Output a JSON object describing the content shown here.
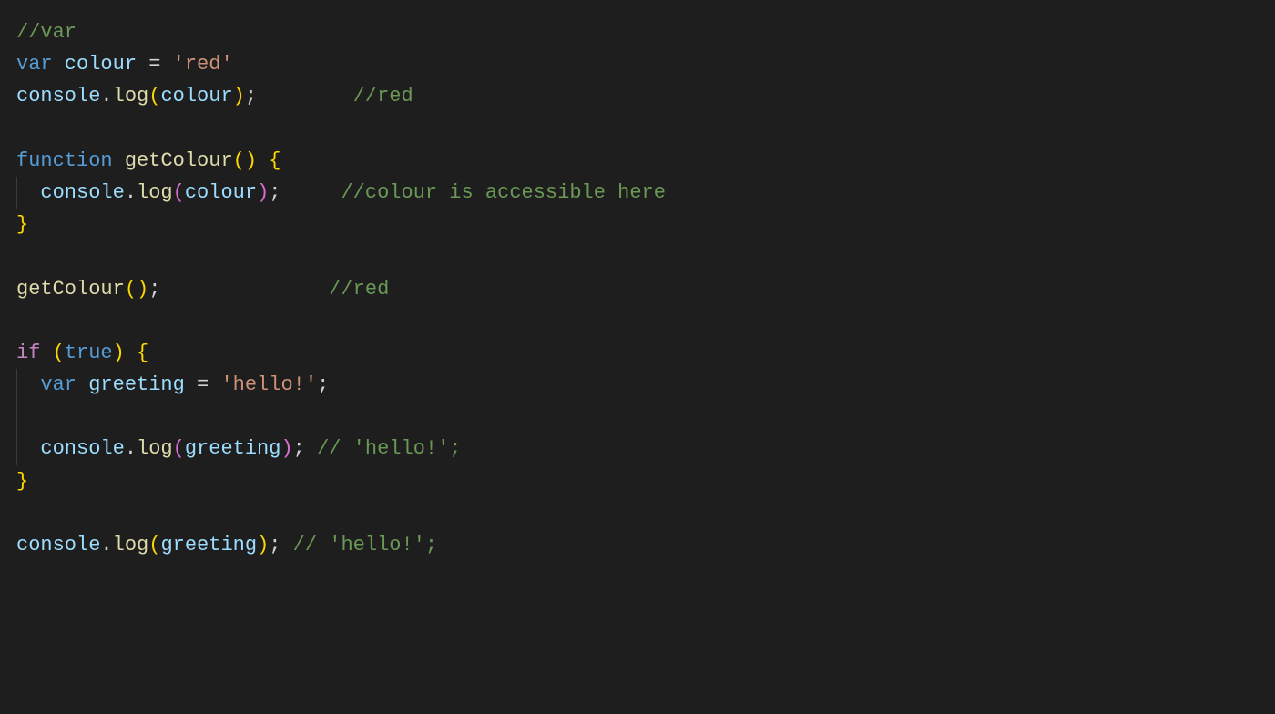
{
  "code": {
    "l1_comment": "//var",
    "l2_var": "var",
    "l2_colour": " colour ",
    "l2_eq": "= ",
    "l2_str": "'red'",
    "l3_console": "console",
    "l3_dot": ".",
    "l3_log": "log",
    "l3_open": "(",
    "l3_arg": "colour",
    "l3_close": ")",
    "l3_semi": ";",
    "l3_pad": "        ",
    "l3_comment": "//red",
    "l5_func": "function",
    "l5_name": " getColour",
    "l5_open": "(",
    "l5_close": ")",
    "l5_sp": " ",
    "l5_brace": "{",
    "l6_indent": "  ",
    "l6_console": "console",
    "l6_dot": ".",
    "l6_log": "log",
    "l6_open": "(",
    "l6_arg": "colour",
    "l6_close": ")",
    "l6_semi": ";",
    "l6_pad": "     ",
    "l6_comment": "//colour is accessible here",
    "l7_brace": "}",
    "l9_call": "getColour",
    "l9_open": "(",
    "l9_close": ")",
    "l9_semi": ";",
    "l9_pad": "              ",
    "l9_comment": "//red",
    "l11_if": "if",
    "l11_sp": " ",
    "l11_open": "(",
    "l11_true": "true",
    "l11_close": ")",
    "l11_sp2": " ",
    "l11_brace": "{",
    "l12_indent": "  ",
    "l12_var": "var",
    "l12_greet": " greeting ",
    "l12_eq": "= ",
    "l12_str": "'hello!'",
    "l12_semi": ";",
    "l14_indent": "  ",
    "l14_console": "console",
    "l14_dot": ".",
    "l14_log": "log",
    "l14_open": "(",
    "l14_arg": "greeting",
    "l14_close": ")",
    "l14_semi": ";",
    "l14_sp": " ",
    "l14_comment": "// 'hello!';",
    "l15_brace": "}",
    "l17_console": "console",
    "l17_dot": ".",
    "l17_log": "log",
    "l17_open": "(",
    "l17_arg": "greeting",
    "l17_close": ")",
    "l17_semi": ";",
    "l17_sp": " ",
    "l17_comment": "// 'hello!';"
  }
}
